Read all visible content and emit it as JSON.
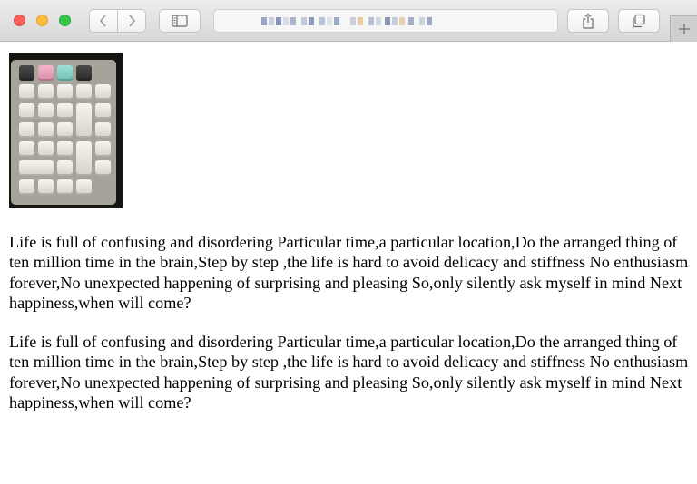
{
  "window": {
    "address_bar_blurred": true,
    "colors": {
      "close": "#fc605c",
      "minimize": "#fdbc40",
      "zoom": "#34c84a"
    }
  },
  "toolbar": {
    "back_icon": "chevron-left-icon",
    "forward_icon": "chevron-right-icon",
    "sidebar_icon": "sidebar-icon",
    "share_icon": "share-icon",
    "tabs_icon": "tab-overview-icon",
    "new_tab_icon": "plus-icon"
  },
  "page": {
    "image": {
      "subject": "keyboard-numpad-photo"
    },
    "paragraphs": [
      "Life is full of confusing and disordering Particular time,a particular location,Do the arranged thing of ten million time in the brain,Step by step ,the life is hard to avoid delicacy and stiffness No enthusiasm forever,No unexpected happening of surprising and pleasing So,only silently ask myself in mind Next happiness,when will come?",
      "Life is full of confusing and disordering Particular time,a particular location,Do the arranged thing of ten million time in the brain,Step by step ,the life is hard to avoid delicacy and stiffness No enthusiasm forever,No unexpected happening of surprising and pleasing So,only silently ask myself in mind Next happiness,when will come?"
    ]
  }
}
